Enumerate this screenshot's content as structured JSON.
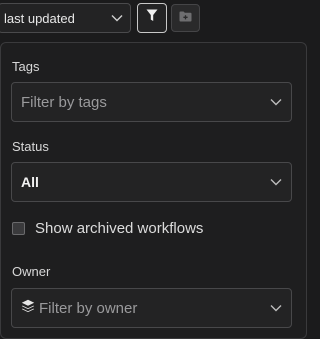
{
  "toolbar": {
    "sort_value": "last updated",
    "sort_icon": "chevron-down-icon",
    "filter_icon": "funnel-icon",
    "folder_icon": "folder-plus-icon"
  },
  "filters": {
    "tags": {
      "label": "Tags",
      "placeholder": "Filter by tags"
    },
    "status": {
      "label": "Status",
      "value": "All"
    },
    "archived": {
      "label": "Show archived workflows",
      "checked": false
    },
    "owner": {
      "label": "Owner",
      "placeholder": "Filter by owner",
      "icon": "layers-icon"
    }
  },
  "colors": {
    "background": "#1b1b1c",
    "panel": "#1e1e1f",
    "border": "#48484a",
    "text": "#e4e4e4",
    "placeholder": "#9a9a9c"
  }
}
